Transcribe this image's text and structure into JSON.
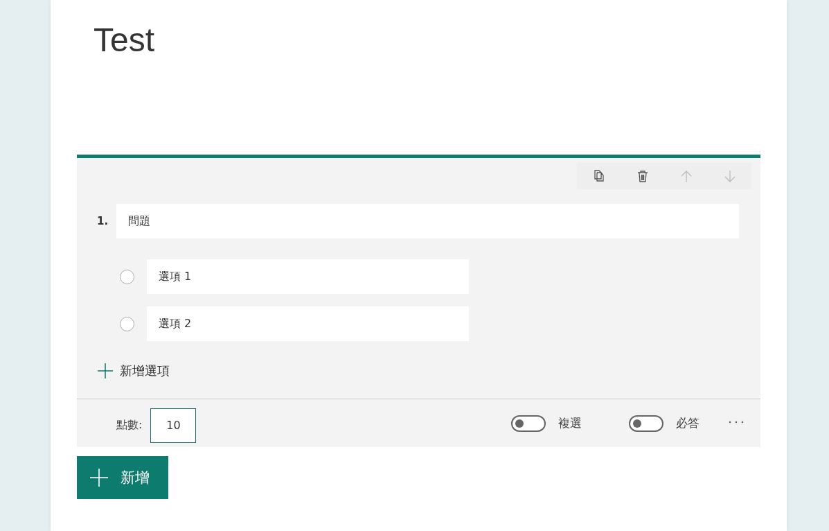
{
  "form_title": "Test",
  "question": {
    "number": "1.",
    "title": "問題",
    "toolbar": [
      {
        "kind": "copy",
        "disabled": false
      },
      {
        "kind": "delete",
        "disabled": false
      },
      {
        "kind": "up",
        "disabled": true
      },
      {
        "kind": "down",
        "disabled": true
      }
    ],
    "options": [
      {
        "text": "選項 1",
        "selected": false
      },
      {
        "text": "選項 2",
        "selected": false
      }
    ],
    "add_option": "新增選項",
    "points_label": "點數:",
    "points_value": "10",
    "toggles": [
      {
        "label": "複選",
        "on": false
      },
      {
        "label": "必答",
        "on": false
      }
    ]
  },
  "add_button": "新增"
}
